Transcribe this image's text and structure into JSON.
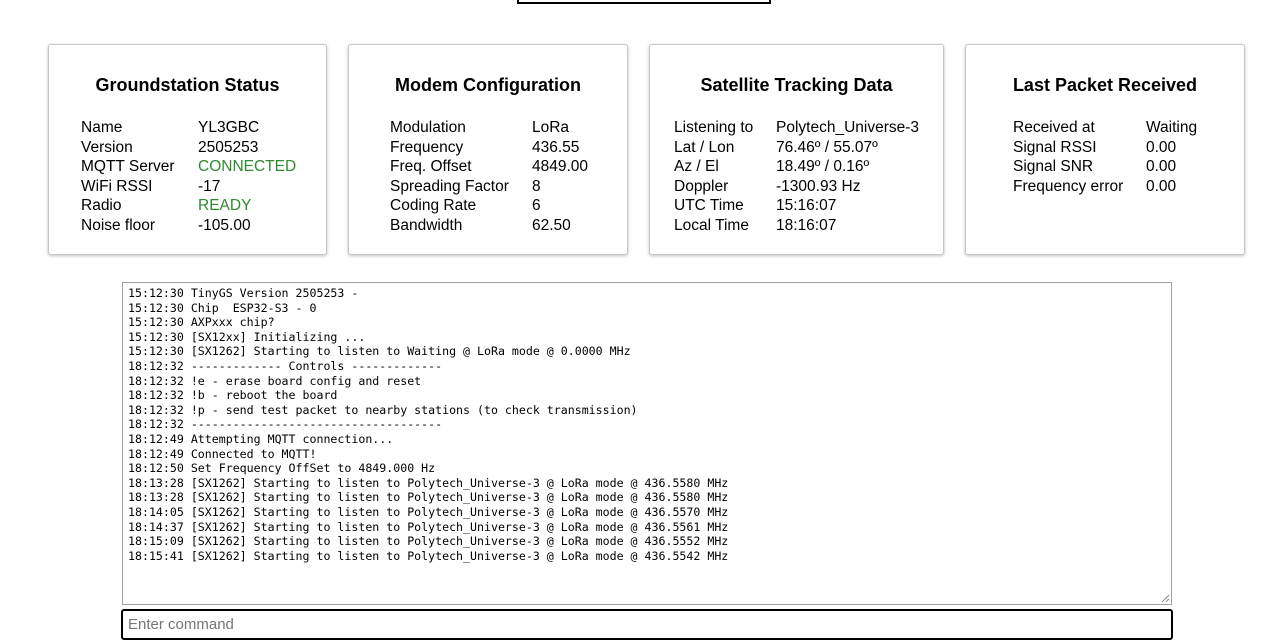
{
  "cards": {
    "groundstation": {
      "title": "Groundstation Status",
      "rows": [
        {
          "label": "Name",
          "value": "YL3GBC"
        },
        {
          "label": "Version",
          "value": "2505253"
        },
        {
          "label": "MQTT Server",
          "value": "CONNECTED"
        },
        {
          "label": "WiFi RSSI",
          "value": "-17"
        },
        {
          "label": "Radio",
          "value": "READY"
        },
        {
          "label": "Noise floor",
          "value": "-105.00"
        }
      ]
    },
    "modem": {
      "title": "Modem Configuration",
      "rows": [
        {
          "label": "Modulation",
          "value": "LoRa"
        },
        {
          "label": "Frequency",
          "value": "436.55"
        },
        {
          "label": "Freq. Offset",
          "value": "4849.00"
        },
        {
          "label": "Spreading Factor",
          "value": "8"
        },
        {
          "label": "Coding Rate",
          "value": "6"
        },
        {
          "label": "Bandwidth",
          "value": "62.50"
        }
      ]
    },
    "satellite": {
      "title": "Satellite Tracking Data",
      "rows": [
        {
          "label": "Listening to",
          "value": "Polytech_Universe-3"
        },
        {
          "label": "Lat / Lon",
          "value": "76.46º / 55.07º"
        },
        {
          "label": "Az / El",
          "value": "18.49º / 0.16º"
        },
        {
          "label": "Doppler",
          "value": "-1300.93 Hz"
        },
        {
          "label": "UTC Time",
          "value": "15:16:07"
        },
        {
          "label": "Local Time",
          "value": "18:16:07"
        }
      ]
    },
    "packet": {
      "title": "Last Packet Received",
      "rows": [
        {
          "label": "Received at",
          "value": "Waiting"
        },
        {
          "label": "Signal RSSI",
          "value": "0.00"
        },
        {
          "label": "Signal SNR",
          "value": "0.00"
        },
        {
          "label": "Frequency error",
          "value": "0.00"
        }
      ]
    }
  },
  "status_color": "#2e8b2e",
  "console": {
    "lines": [
      "15:12:30 TinyGS Version 2505253 -",
      "15:12:30 Chip  ESP32-S3 - 0",
      "15:12:30 AXPxxx chip?",
      "15:12:30 [SX12xx] Initializing ...",
      "15:12:30 [SX1262] Starting to listen to Waiting @ LoRa mode @ 0.0000 MHz",
      "18:12:32 ------------- Controls -------------",
      "18:12:32 !e - erase board config and reset",
      "18:12:32 !b - reboot the board",
      "18:12:32 !p - send test packet to nearby stations (to check transmission)",
      "18:12:32 ------------------------------------",
      "18:12:49 Attempting MQTT connection...",
      "18:12:49 Connected to MQTT!",
      "18:12:50 Set Frequency OffSet to 4849.000 Hz",
      "18:13:28 [SX1262] Starting to listen to Polytech_Universe-3 @ LoRa mode @ 436.5580 MHz",
      "18:13:28 [SX1262] Starting to listen to Polytech_Universe-3 @ LoRa mode @ 436.5580 MHz",
      "18:14:05 [SX1262] Starting to listen to Polytech_Universe-3 @ LoRa mode @ 436.5570 MHz",
      "18:14:37 [SX1262] Starting to listen to Polytech_Universe-3 @ LoRa mode @ 436.5561 MHz",
      "18:15:09 [SX1262] Starting to listen to Polytech_Universe-3 @ LoRa mode @ 436.5552 MHz",
      "18:15:41 [SX1262] Starting to listen to Polytech_Universe-3 @ LoRa mode @ 436.5542 MHz"
    ]
  },
  "command": {
    "placeholder": "Enter command",
    "value": ""
  }
}
